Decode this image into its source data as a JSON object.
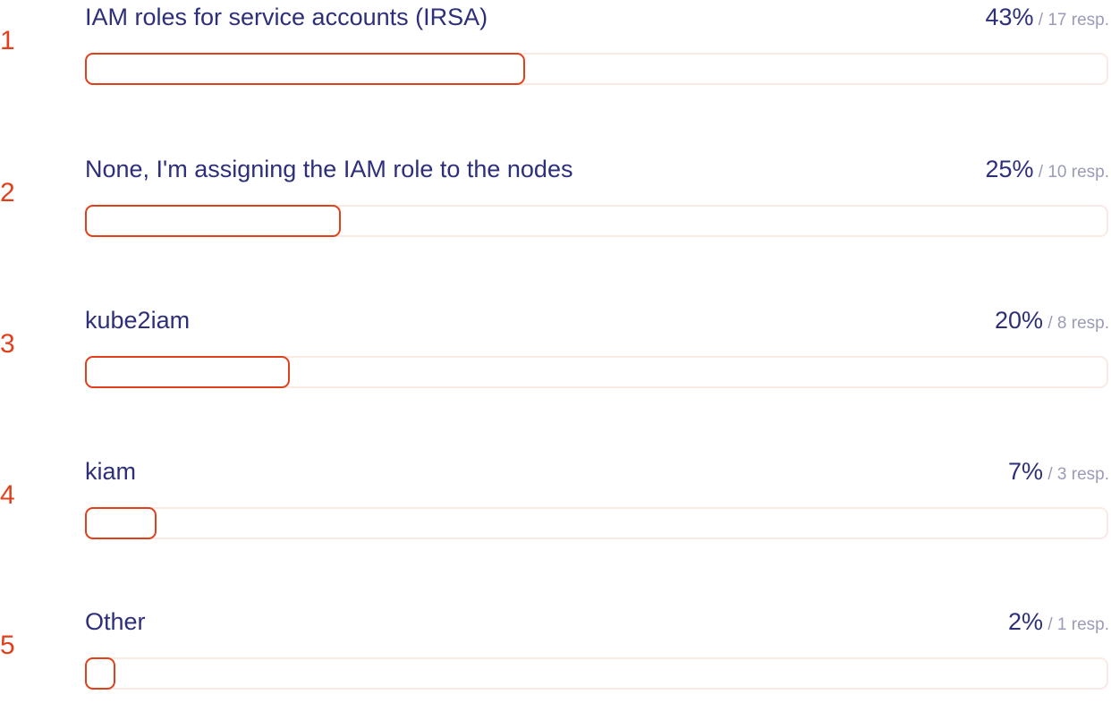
{
  "chart_data": {
    "type": "bar",
    "orientation": "horizontal",
    "xlim": [
      0,
      100
    ],
    "rows": [
      {
        "rank": "1",
        "label": "IAM roles for service accounts (IRSA)",
        "percent_label": "43%",
        "percent": 43,
        "responses": "17",
        "resp_label": "resp."
      },
      {
        "rank": "2",
        "label": "None, I'm assigning the IAM role to the nodes",
        "percent_label": "25%",
        "percent": 25,
        "responses": "10",
        "resp_label": "resp."
      },
      {
        "rank": "3",
        "label": "kube2iam",
        "percent_label": "20%",
        "percent": 20,
        "responses": "8",
        "resp_label": "resp."
      },
      {
        "rank": "4",
        "label": "kiam",
        "percent_label": "7%",
        "percent": 7,
        "responses": "3",
        "resp_label": "resp."
      },
      {
        "rank": "5",
        "label": "Other",
        "percent_label": "2%",
        "percent": 2,
        "responses": "1",
        "resp_label": "resp."
      }
    ],
    "colors": {
      "accent": "#e0401c",
      "text": "#2e2f7a",
      "muted": "#9a9bb8",
      "track_border": "#fbe9e4"
    }
  }
}
